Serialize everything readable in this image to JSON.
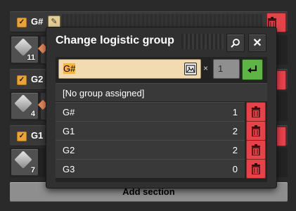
{
  "sections": [
    {
      "name": "G#",
      "count": "11"
    },
    {
      "name": "G2",
      "count": "4"
    },
    {
      "name": "G1",
      "count": "7"
    }
  ],
  "add_section_label": "Add section",
  "dialog": {
    "title": "Change logistic group",
    "name_input_value": "G#",
    "multiplier_symbol": "×",
    "multiplier_value": "1",
    "no_group_label": "[No group assigned]",
    "groups": [
      {
        "name": "G#",
        "count": "1"
      },
      {
        "name": "G1",
        "count": "2"
      },
      {
        "name": "G2",
        "count": "2"
      },
      {
        "name": "G3",
        "count": "0"
      }
    ]
  },
  "colors": {
    "accent_orange": "#e8a33d",
    "delete_red": "#e4434a",
    "confirm_green": "#5eb546",
    "input_bg": "#f2dbb0"
  }
}
